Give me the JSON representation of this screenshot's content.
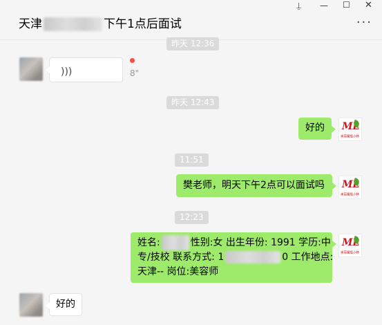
{
  "header": {
    "title_prefix": "天津",
    "title_suffix": "下午1点后面试",
    "pin_icon": "pin-icon",
    "minimize_icon": "minimize-icon",
    "maximize_icon": "maximize-icon",
    "close_icon": "close-icon",
    "more_icon": "more-icon"
  },
  "messages": {
    "t1": "昨天 12:36",
    "voice_duration": "8\"",
    "t2": "昨天 12:43",
    "m1": "好的",
    "t3": "11:51",
    "m2": "樊老师，明天下午2点可以面试吗",
    "t4": "12:23",
    "m3_line1_a": "姓名:",
    "m3_line1_b": "性别:女 出生年份: 1991 学历:中",
    "m3_line2_a": "专/技校 联系方式: 1",
    "m3_line2_b": "0 工作地点:",
    "m3_line3": "天津-- 岗位:美容师",
    "m4": "好的"
  },
  "logo": {
    "mark": "ML",
    "caption": "美丽魔瓶小林",
    "brand_red": "#c8171e",
    "brand_green": "#5aa02c"
  },
  "colors": {
    "sent_bubble": "#9eea6a",
    "received_bubble": "#ffffff",
    "background": "#f5f5f5",
    "time_pill": "#dadada"
  }
}
